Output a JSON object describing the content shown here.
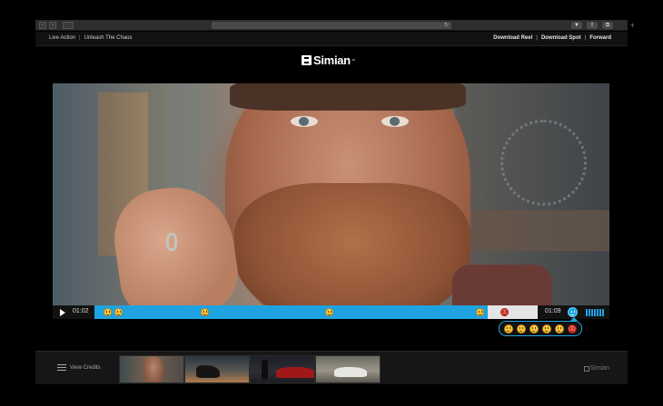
{
  "browser": {
    "back_icon": "chevron-left-icon",
    "forward_icon": "chevron-right-icon",
    "reload_glyph": "↻"
  },
  "topnav": {
    "left": [
      "Live Action",
      "Unleash The Chaos"
    ],
    "right": [
      "Download Reel",
      "Download Spot",
      "Forward"
    ],
    "separator": "|"
  },
  "brand": {
    "name": "Simian",
    "tm": "™"
  },
  "player": {
    "current_time": "01:02",
    "end_time": "01:09",
    "accent_color": "#1ea3e0",
    "progress_buffered_fraction": 0.887,
    "track_reactions": [
      {
        "type": "smile",
        "color": "yellow",
        "at": 0.02
      },
      {
        "type": "laugh",
        "color": "yellow",
        "at": 0.045
      },
      {
        "type": "smile",
        "color": "yellow",
        "at": 0.24
      },
      {
        "type": "laugh",
        "color": "yellow",
        "at": 0.52
      },
      {
        "type": "smile",
        "color": "yellow",
        "at": 0.86
      },
      {
        "type": "angry",
        "color": "red",
        "at": 0.915
      }
    ],
    "reaction_picker": [
      "smile",
      "grin",
      "neutral",
      "laugh",
      "sad",
      "angry"
    ]
  },
  "footer": {
    "credits_label": "View Credits",
    "thumbnails": [
      "bearded-man",
      "figure-sunset",
      "red-car-night",
      "white-car"
    ],
    "brand": "Simian"
  }
}
